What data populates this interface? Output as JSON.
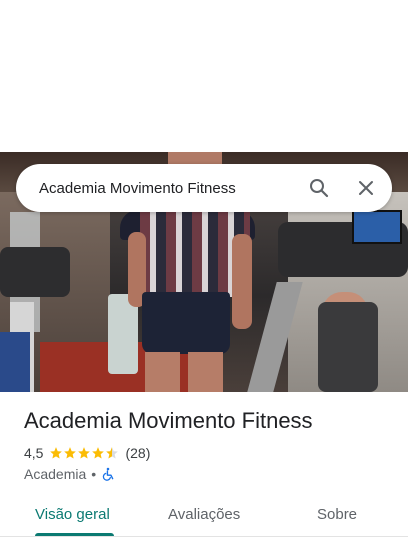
{
  "search": {
    "query": "Academia Movimento Fitness",
    "search_icon": "search-icon",
    "close_icon": "close-icon"
  },
  "place": {
    "title": "Academia Movimento Fitness",
    "rating": "4,5",
    "stars": 4.5,
    "reviews": "(28)",
    "category": "Academia",
    "separator": "•",
    "accessibility_icon": "wheelchair-icon"
  },
  "tabs": [
    {
      "label": "Visão geral",
      "active": true
    },
    {
      "label": "Avaliações",
      "active": false
    },
    {
      "label": "Sobre",
      "active": false
    }
  ],
  "colors": {
    "accent": "#0b7a72",
    "star": "#fbbc04",
    "accessibility": "#1a73e8"
  }
}
